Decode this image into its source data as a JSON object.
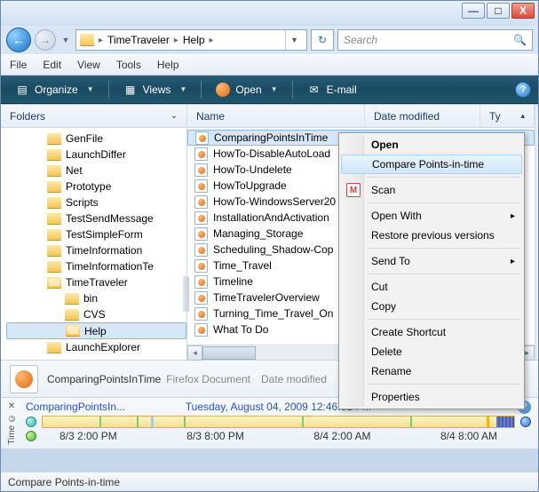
{
  "titlebar": {
    "min": "—",
    "max": "□",
    "close": "X"
  },
  "nav": {
    "breadcrumb": [
      "TimeTraveler",
      "Help"
    ],
    "search_placeholder": "Search"
  },
  "menu": {
    "file": "File",
    "edit": "Edit",
    "view": "View",
    "tools": "Tools",
    "help": "Help"
  },
  "toolbar": {
    "organize": "Organize",
    "views": "Views",
    "open": "Open",
    "email": "E-mail"
  },
  "folders_header": "Folders",
  "tree": [
    {
      "label": "GenFile",
      "indent": 2
    },
    {
      "label": "LaunchDiffer",
      "indent": 2
    },
    {
      "label": "Net",
      "indent": 2
    },
    {
      "label": "Prototype",
      "indent": 2
    },
    {
      "label": "Scripts",
      "indent": 2
    },
    {
      "label": "TestSendMessage",
      "indent": 2
    },
    {
      "label": "TestSimpleForm",
      "indent": 2
    },
    {
      "label": "TimeInformation",
      "indent": 2
    },
    {
      "label": "TimeInformationTe",
      "indent": 2
    },
    {
      "label": "TimeTraveler",
      "indent": 2,
      "open": true
    },
    {
      "label": "bin",
      "indent": 3
    },
    {
      "label": "CVS",
      "indent": 3
    },
    {
      "label": "Help",
      "indent": 3,
      "selected": true,
      "open": true
    },
    {
      "label": "LaunchExplorer",
      "indent": 2
    }
  ],
  "columns": {
    "name": "Name",
    "date": "Date modified",
    "type": "Ty"
  },
  "files": [
    {
      "name": "ComparingPointsInTime",
      "selected": true
    },
    {
      "name": "HowTo-DisableAutoLoad"
    },
    {
      "name": "HowTo-Undelete"
    },
    {
      "name": "HowToUpgrade"
    },
    {
      "name": "HowTo-WindowsServer20"
    },
    {
      "name": "InstallationAndActivation"
    },
    {
      "name": "Managing_Storage"
    },
    {
      "name": "Scheduling_Shadow-Cop"
    },
    {
      "name": "Time_Travel"
    },
    {
      "name": "Timeline"
    },
    {
      "name": "TimeTravelerOverview"
    },
    {
      "name": "Turning_Time_Travel_On"
    },
    {
      "name": "What To Do"
    }
  ],
  "context_menu": {
    "open": "Open",
    "compare": "Compare Points-in-time",
    "scan": "Scan",
    "open_with": "Open With",
    "restore": "Restore previous versions",
    "send_to": "Send To",
    "cut": "Cut",
    "copy": "Copy",
    "shortcut": "Create Shortcut",
    "delete": "Delete",
    "rename": "Rename",
    "properties": "Properties"
  },
  "details": {
    "name": "ComparingPointsInTime",
    "type": "Firefox Document",
    "mod_label": "Date modified"
  },
  "timeline": {
    "name": "ComparingPointsIn...",
    "datetime": "Tuesday, August 04, 2009 12:46:31 PM",
    "ticks": [
      "8/3 2:00 PM",
      "8/3 8:00 PM",
      "8/4 2:00 AM",
      "8/4 8:00 AM"
    ],
    "side_label": "Time ©"
  },
  "status": "Compare Points-in-time"
}
